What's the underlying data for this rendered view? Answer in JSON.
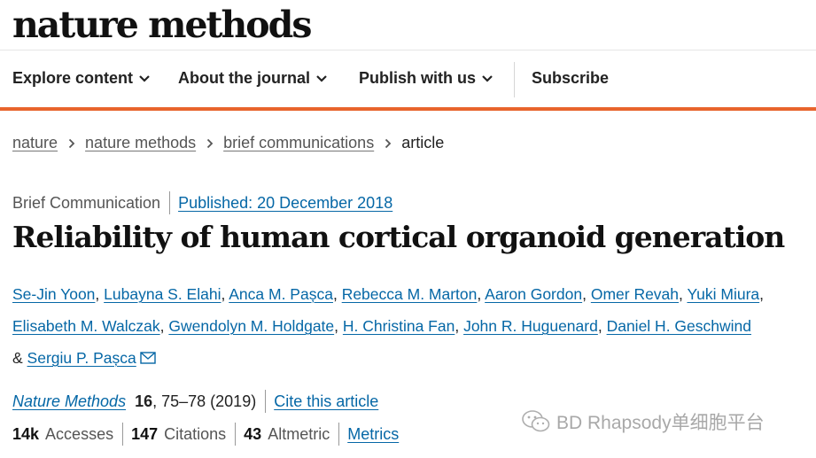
{
  "header": {
    "brand": "nature methods",
    "nav": [
      {
        "label": "Explore content",
        "has_dropdown": true
      },
      {
        "label": "About the journal",
        "has_dropdown": true
      },
      {
        "label": "Publish with us",
        "has_dropdown": true
      },
      {
        "label": "Subscribe",
        "has_dropdown": false
      }
    ],
    "accent_color": "#e8642c"
  },
  "breadcrumb": [
    "nature",
    "nature methods",
    "brief communications",
    "article"
  ],
  "article": {
    "type": "Brief Communication",
    "published": "Published: 20 December 2018",
    "title": "Reliability of human cortical organoid generation",
    "authors": [
      "Se-Jin Yoon",
      "Lubayna S. Elahi",
      "Anca M. Pașca",
      "Rebecca M. Marton",
      "Aaron Gordon",
      "Omer Revah",
      "Yuki Miura",
      "Elisabeth M. Walczak",
      "Gwendolyn M. Holdgate",
      "H. Christina Fan",
      "John R. Huguenard",
      "Daniel H. Geschwind",
      "Sergiu P. Pașca"
    ],
    "journal_name": "Nature Methods",
    "volume": "16",
    "pages_year": ", 75–78 (2019)",
    "cite_label": "Cite this article",
    "metrics": {
      "accesses_value": "14k",
      "accesses_label": "Accesses",
      "citations_value": "147",
      "citations_label": "Citations",
      "altmetric_value": "43",
      "altmetric_label": "Altmetric",
      "metrics_link": "Metrics"
    }
  },
  "watermark": {
    "text": "BD Rhapsody单细胞平台",
    "icon": "wechat-icon"
  }
}
